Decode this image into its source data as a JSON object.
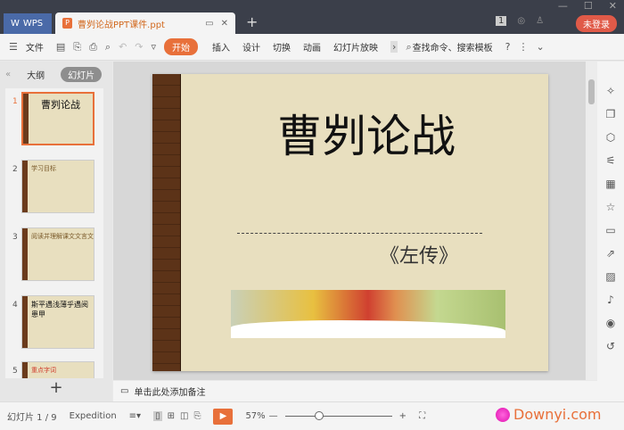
{
  "titlebar": {
    "wps_label": "WPS",
    "doc_tab": "曹刿论战PPT课件.ppt",
    "new_tab": "+",
    "login": "未登录",
    "page_badge": "1"
  },
  "toolbar": {
    "menu": "文件",
    "tabs": [
      "开始",
      "插入",
      "设计",
      "切换",
      "动画",
      "幻灯片放映"
    ],
    "search": "查找命令、搜索模板",
    "help": "?"
  },
  "left_panel": {
    "tab_outline": "大纲",
    "tab_slides": "幻灯片",
    "slides": [
      {
        "num": "1",
        "text": "曹刿论战"
      },
      {
        "num": "2",
        "text": "学习目标"
      },
      {
        "num": "3",
        "text": "阅读并理解课文文言文"
      },
      {
        "num": "4",
        "text": "斯平遇浅薄乎遇阅患甲"
      },
      {
        "num": "5",
        "text": "重点字词"
      }
    ],
    "add": "+"
  },
  "slide": {
    "title": "曹刿论战",
    "subtitle": "《左传》"
  },
  "notes": {
    "placeholder": "单击此处添加备注"
  },
  "status": {
    "slide_counter": "幻灯片 1 / 9",
    "theme": "Expedition",
    "zoom": "57%",
    "zoom_fraction": 0.3
  },
  "watermark": {
    "text": "Downyi.com"
  }
}
